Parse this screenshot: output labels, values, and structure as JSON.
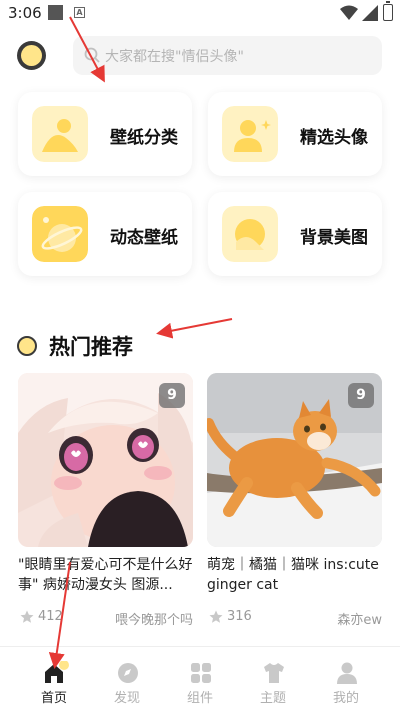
{
  "status_bar": {
    "time": "3:06",
    "notif_icon": "A"
  },
  "search": {
    "placeholder": "大家都在搜\"情侣头像\""
  },
  "categories": [
    {
      "label": "壁纸分类",
      "icon": "landscape-icon"
    },
    {
      "label": "精选头像",
      "icon": "person-icon"
    },
    {
      "label": "动态壁纸",
      "icon": "planet-icon"
    },
    {
      "label": "背景美图",
      "icon": "image-icon"
    }
  ],
  "section": {
    "title": "热门推荐"
  },
  "posts": [
    {
      "count": "9",
      "title": "\"眼睛里有爱心可不是什么好事\" 病娇动漫女头 图源...",
      "likes": "412",
      "author": "喂今晚那个吗"
    },
    {
      "count": "9",
      "title": "萌宠｜橘猫｜猫咪 ins:cute ginger cat",
      "likes": "316",
      "author": "森亦ew"
    }
  ],
  "tabs": [
    {
      "label": "首页",
      "icon": "home-icon",
      "active": true
    },
    {
      "label": "发现",
      "icon": "discover-icon",
      "active": false
    },
    {
      "label": "组件",
      "icon": "widgets-icon",
      "active": false
    },
    {
      "label": "主题",
      "icon": "tshirt-icon",
      "active": false
    },
    {
      "label": "我的",
      "icon": "profile-icon",
      "active": false
    }
  ],
  "colors": {
    "accent_yellow": "#ffe58a",
    "icon_yellow": "#ffd75a",
    "annotation_red": "#e53935"
  }
}
